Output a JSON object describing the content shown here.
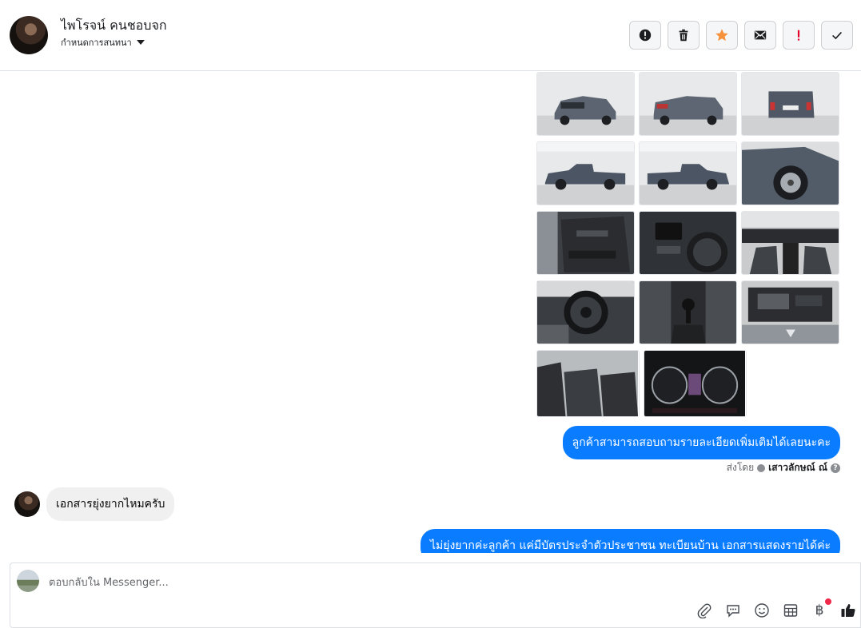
{
  "header": {
    "contact_name": "ไพโรจน์ คนชอบจก",
    "conversation_setting": "กำหนดการสนทนา",
    "actions": [
      {
        "name": "report-spam-button",
        "icon": "alert-circle-icon"
      },
      {
        "name": "delete-button",
        "icon": "trash-icon"
      },
      {
        "name": "star-button",
        "icon": "star-icon",
        "color": "#f7923b"
      },
      {
        "name": "mark-unread-button",
        "icon": "envelope-icon"
      },
      {
        "name": "follow-up-button",
        "icon": "exclamation-icon",
        "color": "#e4002b"
      },
      {
        "name": "mark-done-button",
        "icon": "check-icon"
      }
    ]
  },
  "thread": {
    "photos": [
      {
        "kind": "car-front"
      },
      {
        "kind": "car-rear-angle"
      },
      {
        "kind": "car-rear"
      },
      {
        "kind": "car-side-left"
      },
      {
        "kind": "car-side-right"
      },
      {
        "kind": "car-wheel"
      },
      {
        "kind": "door-interior"
      },
      {
        "kind": "dashboard-console"
      },
      {
        "kind": "cabin-front"
      },
      {
        "kind": "steering-wheel"
      },
      {
        "kind": "gear-shift"
      },
      {
        "kind": "engine-bay"
      },
      {
        "kind": "rear-seats"
      },
      {
        "kind": "gauge-cluster"
      }
    ],
    "outgoing_message_1": "ลูกค้าสามารถสอบถามรายละเอียดเพิ่มเติมได้เลยนะคะ",
    "sent_by_label": "ส่งโดย",
    "sent_by_agent": "เสาวลักษณ์ ณ์",
    "incoming_message": "เอกสารยุ่งยากไหมครับ",
    "outgoing_message_2": "ไม่ยุ่งยากค่ะลูกค้า แค่มีบัตรประจำตัวประชาชน ทะเบียนบ้าน เอกสารแสดงรายได้ค่ะ"
  },
  "composer": {
    "placeholder": "ตอบกลับใน Messenger...",
    "tools": [
      "attachment-icon",
      "saved-reply-icon",
      "emoji-icon",
      "table-icon",
      "baht-icon",
      "thumbs-up-icon"
    ]
  },
  "colors": {
    "accent": "#0a7cff",
    "incoming_bubble": "#f0f0f0",
    "star": "#f7923b",
    "alert": "#e4002b"
  }
}
